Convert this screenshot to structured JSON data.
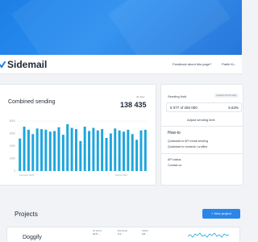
{
  "header": {
    "brand": "Sidemail",
    "feedback_link": "Feedback about this page?",
    "user_name": "Patrik Kr..."
  },
  "combined": {
    "title": "Combined sending",
    "period_label": "30 days",
    "total": "138 435",
    "y_ticks": [
      "8000",
      "6000",
      "4000",
      "2000",
      "0"
    ],
    "x_labels": [
      "February 2023",
      "March 2023"
    ]
  },
  "chart_data": {
    "type": "bar",
    "ylim": [
      0,
      8000
    ],
    "values": [
      5200,
      7100,
      6600,
      5900,
      6800,
      6700,
      6600,
      6300,
      6400,
      7000,
      5800,
      7500,
      6900,
      6700,
      4800,
      7100,
      6400,
      6900,
      6500,
      6700,
      5300,
      6000,
      6800,
      6500,
      6300,
      6600,
      5900,
      5000,
      6500,
      6600
    ],
    "grid": true,
    "color": "#1ea5dd"
  },
  "sending_limit": {
    "label": "Sending limit",
    "badge": "Updated at 8:42 today",
    "usage": "5 077 of 250 000",
    "percent": "5.63%",
    "adjust_link": "Adjust sending limit"
  },
  "howto": {
    "title": "How-to",
    "links": [
      "Quickstart to API email sending",
      "Quickstart to contacts / profiles"
    ],
    "extra_links": [
      "API status",
      "Contact us"
    ]
  },
  "projects": {
    "title": "Projects",
    "new_button": "+ New project",
    "rows": [
      {
        "name": "Doggify",
        "columns": [
          {
            "header": "30 DAYS",
            "value": "13 5 ..."
          },
          {
            "header": "BOUNCE",
            "value": "0.1 ..."
          },
          {
            "header": "SPAM",
            "value": "0.0 ..."
          }
        ]
      }
    ]
  },
  "colors": {
    "hero": "#1d7fe6",
    "accent": "#2b86e8",
    "bar": "#1ea5dd"
  }
}
